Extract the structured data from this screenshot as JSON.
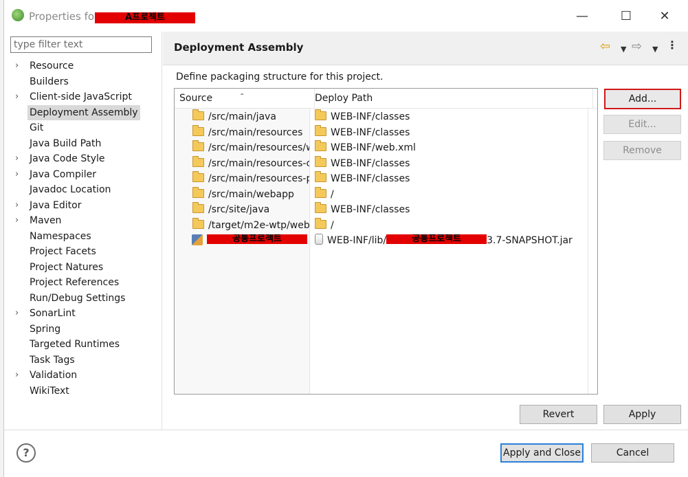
{
  "window": {
    "title_prefix": "Properties for",
    "title_redacted": "A프로젝트",
    "minimize": "—",
    "maximize": "☐",
    "close": "✕"
  },
  "filter": {
    "placeholder": "type filter text",
    "value": ""
  },
  "tree": {
    "items": [
      {
        "label": "Resource",
        "expandable": true
      },
      {
        "label": "Builders",
        "expandable": false
      },
      {
        "label": "Client-side JavaScript",
        "expandable": true
      },
      {
        "label": "Deployment Assembly",
        "expandable": false,
        "selected": true
      },
      {
        "label": "Git",
        "expandable": false
      },
      {
        "label": "Java Build Path",
        "expandable": false
      },
      {
        "label": "Java Code Style",
        "expandable": true
      },
      {
        "label": "Java Compiler",
        "expandable": true
      },
      {
        "label": "Javadoc Location",
        "expandable": false
      },
      {
        "label": "Java Editor",
        "expandable": true
      },
      {
        "label": "Maven",
        "expandable": true
      },
      {
        "label": "Namespaces",
        "expandable": false
      },
      {
        "label": "Project Facets",
        "expandable": false
      },
      {
        "label": "Project Natures",
        "expandable": false
      },
      {
        "label": "Project References",
        "expandable": false
      },
      {
        "label": "Run/Debug Settings",
        "expandable": false
      },
      {
        "label": "SonarLint",
        "expandable": true
      },
      {
        "label": "Spring",
        "expandable": false
      },
      {
        "label": "Targeted Runtimes",
        "expandable": false
      },
      {
        "label": "Task Tags",
        "expandable": false
      },
      {
        "label": "Validation",
        "expandable": true
      },
      {
        "label": "WikiText",
        "expandable": false
      }
    ]
  },
  "page": {
    "title": "Deployment Assembly",
    "description": "Define packaging structure for this project."
  },
  "table": {
    "headers": {
      "source": "Source",
      "deploy_path": "Deploy Path"
    },
    "rows": [
      {
        "source": "/src/main/java",
        "deploy": "WEB-INF/classes",
        "icon": "folder"
      },
      {
        "source": "/src/main/resources",
        "deploy": "WEB-INF/classes",
        "icon": "folder"
      },
      {
        "source": "/src/main/resources/w",
        "deploy": "WEB-INF/web.xml",
        "icon": "folder"
      },
      {
        "source": "/src/main/resources-c",
        "deploy": "WEB-INF/classes",
        "icon": "folder"
      },
      {
        "source": "/src/main/resources-p",
        "deploy": "WEB-INF/classes",
        "icon": "folder"
      },
      {
        "source": "/src/main/webapp",
        "deploy": "/",
        "icon": "folder"
      },
      {
        "source": "/src/site/java",
        "deploy": "WEB-INF/classes",
        "icon": "folder"
      },
      {
        "source": "/target/m2e-wtp/web",
        "deploy": "/",
        "icon": "folder"
      },
      {
        "source_redacted": "공통프로젝트",
        "deploy_prefix": "WEB-INF/lib/",
        "deploy_redacted": "공통프로젝트",
        "deploy_suffix": "3.7-SNAPSHOT.jar",
        "icon": "project"
      }
    ]
  },
  "buttons": {
    "add": "Add...",
    "edit": "Edit...",
    "remove": "Remove",
    "revert": "Revert",
    "apply": "Apply",
    "apply_and_close": "Apply and Close",
    "cancel": "Cancel"
  },
  "icons": {
    "back": "⇦",
    "forward": "⇨",
    "dropdown": "▼",
    "more": "⋮",
    "help": "?",
    "expand": "›",
    "sort": "⌃"
  },
  "colors": {
    "highlight_border": "#d01818",
    "redaction": "#e30000",
    "default_button_border": "#2a7fd6"
  }
}
